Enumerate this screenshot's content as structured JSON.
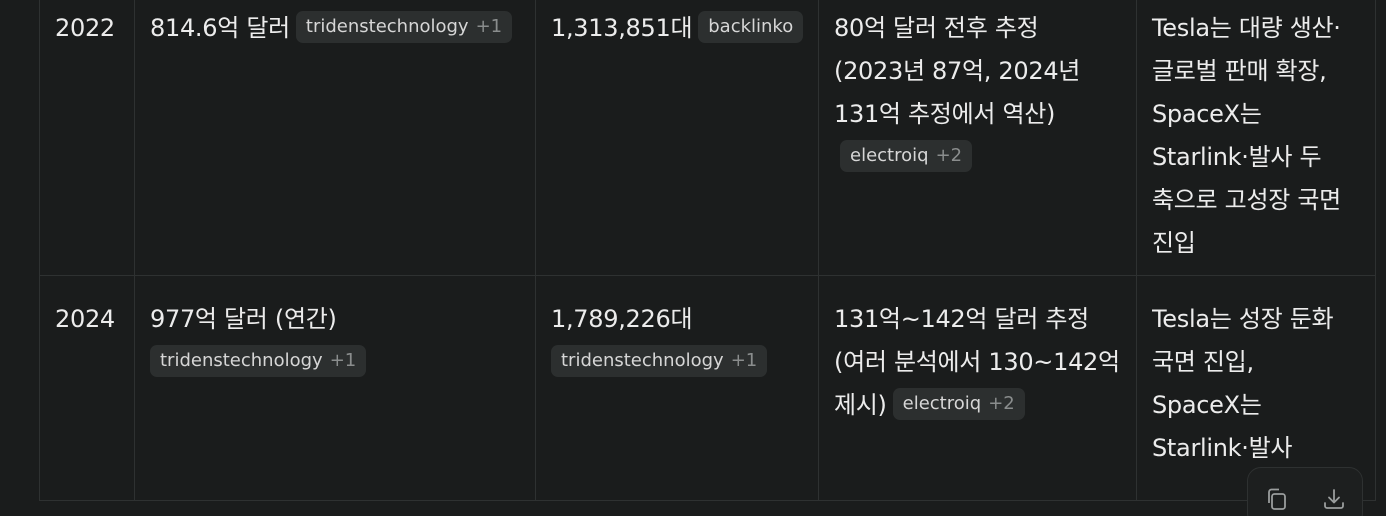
{
  "table": {
    "rows": [
      {
        "year": "2022",
        "revenue": {
          "text": "814.6억 달러",
          "source": "tridenstechnology",
          "extra": "+1"
        },
        "units": {
          "text": "1,313,851대",
          "source": "backlinko",
          "extra": ""
        },
        "estimate": {
          "text": "80억 달러 전후 추정 (2023년 87억, 2024년 131억 추정에서 역산)",
          "source": "electroiq",
          "extra": "+2"
        },
        "note": "Tesla는 대량 생산·글로벌 판매 확장, SpaceX는 Starlink·발사 두 축으로 고성장 국면 진입"
      },
      {
        "year": "2024",
        "revenue": {
          "text": "977억 달러 (연간)",
          "source": "tridenstechnology",
          "extra": "+1"
        },
        "units": {
          "text": "1,789,226대",
          "source": "tridenstechnology",
          "extra": "+1"
        },
        "estimate": {
          "text": "131억~142억 달러 추정 (여러 분석에서 130~142억 제시)",
          "source": "electroiq",
          "extra": "+2"
        },
        "note": "Tesla는 성장 둔화 국면 진입, SpaceX는 Starlink·발사 매출로 고성장 지속"
      }
    ]
  },
  "actions": {
    "copy_icon": "copy-icon",
    "download_icon": "download-icon"
  }
}
